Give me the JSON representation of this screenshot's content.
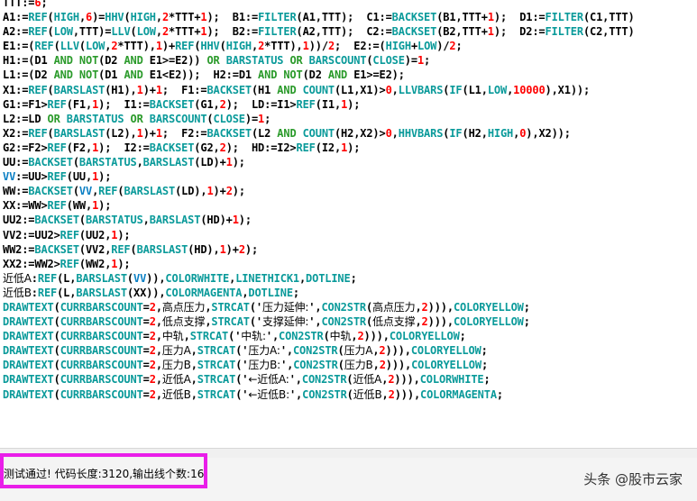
{
  "colors": {
    "function": "#0a9a9a",
    "keyword": "#2a9a2a",
    "number": "#ff0000",
    "identifier": "#0a7fc4",
    "text": "#000000",
    "highlight_border": "#e91ee9"
  },
  "code_lines": [
    [
      [
        "t",
        "TTT:="
      ],
      [
        "n",
        "6"
      ],
      [
        "t",
        ";"
      ]
    ],
    [
      [
        "t",
        "A1:="
      ],
      [
        "f",
        "REF"
      ],
      [
        "t",
        "("
      ],
      [
        "f",
        "HIGH"
      ],
      [
        "t",
        ","
      ],
      [
        "n",
        "6"
      ],
      [
        "t",
        ")="
      ],
      [
        "f",
        "HHV"
      ],
      [
        "t",
        "("
      ],
      [
        "f",
        "HIGH"
      ],
      [
        "t",
        ","
      ],
      [
        "n",
        "2"
      ],
      [
        "t",
        "*TTT+"
      ],
      [
        "n",
        "1"
      ],
      [
        "t",
        ");  B1:="
      ],
      [
        "f",
        "FILTER"
      ],
      [
        "t",
        "(A1,TTT);  C1:="
      ],
      [
        "f",
        "BACKSET"
      ],
      [
        "t",
        "(B1,TTT+"
      ],
      [
        "n",
        "1"
      ],
      [
        "t",
        ");  D1:="
      ],
      [
        "f",
        "FILTER"
      ],
      [
        "t",
        "(C1,TTT)"
      ]
    ],
    [
      [
        "t",
        "A2:="
      ],
      [
        "f",
        "REF"
      ],
      [
        "t",
        "("
      ],
      [
        "f",
        "LOW"
      ],
      [
        "t",
        ",TTT)="
      ],
      [
        "f",
        "LLV"
      ],
      [
        "t",
        "("
      ],
      [
        "f",
        "LOW"
      ],
      [
        "t",
        ","
      ],
      [
        "n",
        "2"
      ],
      [
        "t",
        "*TTT+"
      ],
      [
        "n",
        "1"
      ],
      [
        "t",
        ");  B2:="
      ],
      [
        "f",
        "FILTER"
      ],
      [
        "t",
        "(A2,TTT);  C2:="
      ],
      [
        "f",
        "BACKSET"
      ],
      [
        "t",
        "(B2,TTT+"
      ],
      [
        "n",
        "1"
      ],
      [
        "t",
        ");  D2:="
      ],
      [
        "f",
        "FILTER"
      ],
      [
        "t",
        "(C2,TTT)"
      ]
    ],
    [
      [
        "t",
        "E1:=("
      ],
      [
        "f",
        "REF"
      ],
      [
        "t",
        "("
      ],
      [
        "f",
        "LLV"
      ],
      [
        "t",
        "("
      ],
      [
        "f",
        "LOW"
      ],
      [
        "t",
        ","
      ],
      [
        "n",
        "2"
      ],
      [
        "t",
        "*TTT),"
      ],
      [
        "n",
        "1"
      ],
      [
        "t",
        ")+"
      ],
      [
        "f",
        "REF"
      ],
      [
        "t",
        "("
      ],
      [
        "f",
        "HHV"
      ],
      [
        "t",
        "("
      ],
      [
        "f",
        "HIGH"
      ],
      [
        "t",
        ","
      ],
      [
        "n",
        "2"
      ],
      [
        "t",
        "*TTT),"
      ],
      [
        "n",
        "1"
      ],
      [
        "t",
        "))/"
      ],
      [
        "n",
        "2"
      ],
      [
        "t",
        ";  E2:=("
      ],
      [
        "f",
        "HIGH"
      ],
      [
        "t",
        "+"
      ],
      [
        "f",
        "LOW"
      ],
      [
        "t",
        ")/"
      ],
      [
        "n",
        "2"
      ],
      [
        "t",
        ";"
      ]
    ],
    [
      [
        "t",
        "H1:=(D1 "
      ],
      [
        "k",
        "AND"
      ],
      [
        "t",
        " "
      ],
      [
        "k",
        "NOT"
      ],
      [
        "t",
        "(D2 "
      ],
      [
        "k",
        "AND"
      ],
      [
        "t",
        " E1>=E2)) "
      ],
      [
        "k",
        "OR"
      ],
      [
        "t",
        " "
      ],
      [
        "f",
        "BARSTATUS"
      ],
      [
        "t",
        " "
      ],
      [
        "k",
        "OR"
      ],
      [
        "t",
        " "
      ],
      [
        "f",
        "BARSCOUNT"
      ],
      [
        "t",
        "("
      ],
      [
        "f",
        "CLOSE"
      ],
      [
        "t",
        ")="
      ],
      [
        "n",
        "1"
      ],
      [
        "t",
        ";"
      ]
    ],
    [
      [
        "t",
        "L1:=(D2 "
      ],
      [
        "k",
        "AND"
      ],
      [
        "t",
        " "
      ],
      [
        "k",
        "NOT"
      ],
      [
        "t",
        "(D1 "
      ],
      [
        "k",
        "AND"
      ],
      [
        "t",
        " E1<E2));  H2:=D1 "
      ],
      [
        "k",
        "AND"
      ],
      [
        "t",
        " "
      ],
      [
        "k",
        "NOT"
      ],
      [
        "t",
        "(D2 "
      ],
      [
        "k",
        "AND"
      ],
      [
        "t",
        " E1>=E2);"
      ]
    ],
    [
      [
        "t",
        "X1:="
      ],
      [
        "f",
        "REF"
      ],
      [
        "t",
        "("
      ],
      [
        "f",
        "BARSLAST"
      ],
      [
        "t",
        "(H1),"
      ],
      [
        "n",
        "1"
      ],
      [
        "t",
        ")+"
      ],
      [
        "n",
        "1"
      ],
      [
        "t",
        ";  F1:="
      ],
      [
        "f",
        "BACKSET"
      ],
      [
        "t",
        "(H1 "
      ],
      [
        "k",
        "AND"
      ],
      [
        "t",
        " "
      ],
      [
        "f",
        "COUNT"
      ],
      [
        "t",
        "(L1,X1)>"
      ],
      [
        "n",
        "0"
      ],
      [
        "t",
        ","
      ],
      [
        "f",
        "LLVBARS"
      ],
      [
        "t",
        "("
      ],
      [
        "f",
        "IF"
      ],
      [
        "t",
        "(L1,"
      ],
      [
        "f",
        "LOW"
      ],
      [
        "t",
        ","
      ],
      [
        "n",
        "10000"
      ],
      [
        "t",
        "),X1));"
      ]
    ],
    [
      [
        "t",
        "G1:=F1>"
      ],
      [
        "f",
        "REF"
      ],
      [
        "t",
        "(F1,"
      ],
      [
        "n",
        "1"
      ],
      [
        "t",
        ");  I1:="
      ],
      [
        "f",
        "BACKSET"
      ],
      [
        "t",
        "(G1,"
      ],
      [
        "n",
        "2"
      ],
      [
        "t",
        ");  LD:=I1>"
      ],
      [
        "f",
        "REF"
      ],
      [
        "t",
        "(I1,"
      ],
      [
        "n",
        "1"
      ],
      [
        "t",
        ");"
      ]
    ],
    [
      [
        "t",
        "L2:=LD "
      ],
      [
        "k",
        "OR"
      ],
      [
        "t",
        " "
      ],
      [
        "f",
        "BARSTATUS"
      ],
      [
        "t",
        " "
      ],
      [
        "k",
        "OR"
      ],
      [
        "t",
        " "
      ],
      [
        "f",
        "BARSCOUNT"
      ],
      [
        "t",
        "("
      ],
      [
        "f",
        "CLOSE"
      ],
      [
        "t",
        ")="
      ],
      [
        "n",
        "1"
      ],
      [
        "t",
        ";"
      ]
    ],
    [
      [
        "t",
        "X2:="
      ],
      [
        "f",
        "REF"
      ],
      [
        "t",
        "("
      ],
      [
        "f",
        "BARSLAST"
      ],
      [
        "t",
        "(L2),"
      ],
      [
        "n",
        "1"
      ],
      [
        "t",
        ")+"
      ],
      [
        "n",
        "1"
      ],
      [
        "t",
        ";  F2:="
      ],
      [
        "f",
        "BACKSET"
      ],
      [
        "t",
        "(L2 "
      ],
      [
        "k",
        "AND"
      ],
      [
        "t",
        " "
      ],
      [
        "f",
        "COUNT"
      ],
      [
        "t",
        "(H2,X2)>"
      ],
      [
        "n",
        "0"
      ],
      [
        "t",
        ","
      ],
      [
        "f",
        "HHVBARS"
      ],
      [
        "t",
        "("
      ],
      [
        "f",
        "IF"
      ],
      [
        "t",
        "(H2,"
      ],
      [
        "f",
        "HIGH"
      ],
      [
        "t",
        ","
      ],
      [
        "n",
        "0"
      ],
      [
        "t",
        "),X2));"
      ]
    ],
    [
      [
        "t",
        "G2:=F2>"
      ],
      [
        "f",
        "REF"
      ],
      [
        "t",
        "(F2,"
      ],
      [
        "n",
        "1"
      ],
      [
        "t",
        ");  I2:="
      ],
      [
        "f",
        "BACKSET"
      ],
      [
        "t",
        "(G2,"
      ],
      [
        "n",
        "2"
      ],
      [
        "t",
        ");  HD:=I2>"
      ],
      [
        "f",
        "REF"
      ],
      [
        "t",
        "(I2,"
      ],
      [
        "n",
        "1"
      ],
      [
        "t",
        ");"
      ]
    ],
    [
      [
        "t",
        "UU:="
      ],
      [
        "f",
        "BACKSET"
      ],
      [
        "t",
        "("
      ],
      [
        "f",
        "BARSTATUS"
      ],
      [
        "t",
        ","
      ],
      [
        "f",
        "BARSLAST"
      ],
      [
        "t",
        "(LD)+"
      ],
      [
        "n",
        "1"
      ],
      [
        "t",
        ");"
      ]
    ],
    [
      [
        "i",
        "VV"
      ],
      [
        "t",
        ":=UU>"
      ],
      [
        "f",
        "REF"
      ],
      [
        "t",
        "(UU,"
      ],
      [
        "n",
        "1"
      ],
      [
        "t",
        ");"
      ]
    ],
    [
      [
        "t",
        "WW:="
      ],
      [
        "f",
        "BACKSET"
      ],
      [
        "t",
        "("
      ],
      [
        "i",
        "VV"
      ],
      [
        "t",
        ","
      ],
      [
        "f",
        "REF"
      ],
      [
        "t",
        "("
      ],
      [
        "f",
        "BARSLAST"
      ],
      [
        "t",
        "(LD),"
      ],
      [
        "n",
        "1"
      ],
      [
        "t",
        ")+"
      ],
      [
        "n",
        "2"
      ],
      [
        "t",
        ");"
      ]
    ],
    [
      [
        "t",
        "XX:=WW>"
      ],
      [
        "f",
        "REF"
      ],
      [
        "t",
        "(WW,"
      ],
      [
        "n",
        "1"
      ],
      [
        "t",
        ");"
      ]
    ],
    [
      [
        "t",
        "UU2:="
      ],
      [
        "f",
        "BACKSET"
      ],
      [
        "t",
        "("
      ],
      [
        "f",
        "BARSTATUS"
      ],
      [
        "t",
        ","
      ],
      [
        "f",
        "BARSLAST"
      ],
      [
        "t",
        "(HD)+"
      ],
      [
        "n",
        "1"
      ],
      [
        "t",
        ");"
      ]
    ],
    [
      [
        "t",
        "VV2:=UU2>"
      ],
      [
        "f",
        "REF"
      ],
      [
        "t",
        "(UU2,"
      ],
      [
        "n",
        "1"
      ],
      [
        "t",
        ");"
      ]
    ],
    [
      [
        "t",
        "WW2:="
      ],
      [
        "f",
        "BACKSET"
      ],
      [
        "t",
        "(VV2,"
      ],
      [
        "f",
        "REF"
      ],
      [
        "t",
        "("
      ],
      [
        "f",
        "BARSLAST"
      ],
      [
        "t",
        "(HD),"
      ],
      [
        "n",
        "1"
      ],
      [
        "t",
        ")+"
      ],
      [
        "n",
        "2"
      ],
      [
        "t",
        ");"
      ]
    ],
    [
      [
        "t",
        "XX2:=WW2>"
      ],
      [
        "f",
        "REF"
      ],
      [
        "t",
        "(WW2,"
      ],
      [
        "n",
        "1"
      ],
      [
        "t",
        ");"
      ]
    ],
    [
      [
        "c",
        "近低A"
      ],
      [
        "t",
        ":"
      ],
      [
        "f",
        "REF"
      ],
      [
        "t",
        "(L,"
      ],
      [
        "f",
        "BARSLAST"
      ],
      [
        "t",
        "("
      ],
      [
        "i",
        "VV"
      ],
      [
        "t",
        "))"
      ],
      [
        "t",
        ","
      ],
      [
        "f",
        "COLORWHITE"
      ],
      [
        "t",
        ","
      ],
      [
        "f",
        "LINETHICK1"
      ],
      [
        "t",
        ","
      ],
      [
        "f",
        "DOTLINE"
      ],
      [
        "t",
        ";"
      ]
    ],
    [
      [
        "c",
        "近低B"
      ],
      [
        "t",
        ":"
      ],
      [
        "f",
        "REF"
      ],
      [
        "t",
        "(L,"
      ],
      [
        "f",
        "BARSLAST"
      ],
      [
        "t",
        "(XX)),"
      ],
      [
        "f",
        "COLORMAGENTA"
      ],
      [
        "t",
        ","
      ],
      [
        "f",
        "DOTLINE"
      ],
      [
        "t",
        ";"
      ]
    ],
    [
      [
        "f",
        "DRAWTEXT"
      ],
      [
        "t",
        "("
      ],
      [
        "f",
        "CURRBARSCOUNT"
      ],
      [
        "t",
        "="
      ],
      [
        "n",
        "2"
      ],
      [
        "t",
        ","
      ],
      [
        "c",
        "高点压力"
      ],
      [
        "t",
        ","
      ],
      [
        "f",
        "STRCAT"
      ],
      [
        "t",
        "('"
      ],
      [
        "c",
        "压力延伸:"
      ],
      [
        "t",
        "',"
      ],
      [
        "f",
        "CON2STR"
      ],
      [
        "t",
        "("
      ],
      [
        "c",
        "高点压力"
      ],
      [
        "t",
        ","
      ],
      [
        "n",
        "2"
      ],
      [
        "t",
        ")))"
      ],
      [
        "t",
        ","
      ],
      [
        "f",
        "COLORYELLOW"
      ],
      [
        "t",
        ";"
      ]
    ],
    [
      [
        "f",
        "DRAWTEXT"
      ],
      [
        "t",
        "("
      ],
      [
        "f",
        "CURRBARSCOUNT"
      ],
      [
        "t",
        "="
      ],
      [
        "n",
        "2"
      ],
      [
        "t",
        ","
      ],
      [
        "c",
        "低点支撑"
      ],
      [
        "t",
        ","
      ],
      [
        "f",
        "STRCAT"
      ],
      [
        "t",
        "('"
      ],
      [
        "c",
        "支撑延伸:"
      ],
      [
        "t",
        "',"
      ],
      [
        "f",
        "CON2STR"
      ],
      [
        "t",
        "("
      ],
      [
        "c",
        "低点支撑"
      ],
      [
        "t",
        ","
      ],
      [
        "n",
        "2"
      ],
      [
        "t",
        ")))"
      ],
      [
        "t",
        ","
      ],
      [
        "f",
        "COLORYELLOW"
      ],
      [
        "t",
        ";"
      ]
    ],
    [
      [
        "f",
        "DRAWTEXT"
      ],
      [
        "t",
        "("
      ],
      [
        "f",
        "CURRBARSCOUNT"
      ],
      [
        "t",
        "="
      ],
      [
        "n",
        "2"
      ],
      [
        "t",
        ","
      ],
      [
        "c",
        "中轨"
      ],
      [
        "t",
        ","
      ],
      [
        "f",
        "STRCAT"
      ],
      [
        "t",
        "('"
      ],
      [
        "c",
        "中轨:"
      ],
      [
        "t",
        "',"
      ],
      [
        "f",
        "CON2STR"
      ],
      [
        "t",
        "("
      ],
      [
        "c",
        "中轨"
      ],
      [
        "t",
        ","
      ],
      [
        "n",
        "2"
      ],
      [
        "t",
        ")))"
      ],
      [
        "t",
        ","
      ],
      [
        "f",
        "COLORYELLOW"
      ],
      [
        "t",
        ";"
      ]
    ],
    [
      [
        "f",
        "DRAWTEXT"
      ],
      [
        "t",
        "("
      ],
      [
        "f",
        "CURRBARSCOUNT"
      ],
      [
        "t",
        "="
      ],
      [
        "n",
        "2"
      ],
      [
        "t",
        ","
      ],
      [
        "c",
        "压力A"
      ],
      [
        "t",
        ","
      ],
      [
        "f",
        "STRCAT"
      ],
      [
        "t",
        "('"
      ],
      [
        "c",
        "压力A:"
      ],
      [
        "t",
        "',"
      ],
      [
        "f",
        "CON2STR"
      ],
      [
        "t",
        "("
      ],
      [
        "c",
        "压力A"
      ],
      [
        "t",
        ","
      ],
      [
        "n",
        "2"
      ],
      [
        "t",
        ")))"
      ],
      [
        "t",
        ","
      ],
      [
        "f",
        "COLORYELLOW"
      ],
      [
        "t",
        ";"
      ]
    ],
    [
      [
        "f",
        "DRAWTEXT"
      ],
      [
        "t",
        "("
      ],
      [
        "f",
        "CURRBARSCOUNT"
      ],
      [
        "t",
        "="
      ],
      [
        "n",
        "2"
      ],
      [
        "t",
        ","
      ],
      [
        "c",
        "压力B"
      ],
      [
        "t",
        ","
      ],
      [
        "f",
        "STRCAT"
      ],
      [
        "t",
        "('"
      ],
      [
        "c",
        "压力B:"
      ],
      [
        "t",
        "',"
      ],
      [
        "f",
        "CON2STR"
      ],
      [
        "t",
        "("
      ],
      [
        "c",
        "压力B"
      ],
      [
        "t",
        ","
      ],
      [
        "n",
        "2"
      ],
      [
        "t",
        ")))"
      ],
      [
        "t",
        ","
      ],
      [
        "f",
        "COLORYELLOW"
      ],
      [
        "t",
        ";"
      ]
    ],
    [
      [
        "f",
        "DRAWTEXT"
      ],
      [
        "t",
        "("
      ],
      [
        "f",
        "CURRBARSCOUNT"
      ],
      [
        "t",
        "="
      ],
      [
        "n",
        "2"
      ],
      [
        "t",
        ","
      ],
      [
        "c",
        "近低A"
      ],
      [
        "t",
        ","
      ],
      [
        "f",
        "STRCAT"
      ],
      [
        "t",
        "('"
      ],
      [
        "c",
        "←近低A:"
      ],
      [
        "t",
        "',"
      ],
      [
        "f",
        "CON2STR"
      ],
      [
        "t",
        "("
      ],
      [
        "c",
        "近低A"
      ],
      [
        "t",
        ","
      ],
      [
        "n",
        "2"
      ],
      [
        "t",
        ")))"
      ],
      [
        "t",
        ","
      ],
      [
        "f",
        "COLORWHITE"
      ],
      [
        "t",
        ";"
      ]
    ],
    [
      [
        "f",
        "DRAWTEXT"
      ],
      [
        "t",
        "("
      ],
      [
        "f",
        "CURRBARSCOUNT"
      ],
      [
        "t",
        "="
      ],
      [
        "n",
        "2"
      ],
      [
        "t",
        ","
      ],
      [
        "c",
        "近低B"
      ],
      [
        "t",
        ","
      ],
      [
        "f",
        "STRCAT"
      ],
      [
        "t",
        "('"
      ],
      [
        "c",
        "←近低B:"
      ],
      [
        "t",
        "',"
      ],
      [
        "f",
        "CON2STR"
      ],
      [
        "t",
        "("
      ],
      [
        "c",
        "近低B"
      ],
      [
        "t",
        ","
      ],
      [
        "n",
        "2"
      ],
      [
        "t",
        ")))"
      ],
      [
        "t",
        ","
      ],
      [
        "f",
        "COLORMAGENTA"
      ],
      [
        "t",
        ";"
      ]
    ]
  ],
  "status_bar": {
    "message": "测试通过! 代码长度:3120,输出线个数:16"
  },
  "watermark": {
    "text": "头条 @股市云家"
  }
}
